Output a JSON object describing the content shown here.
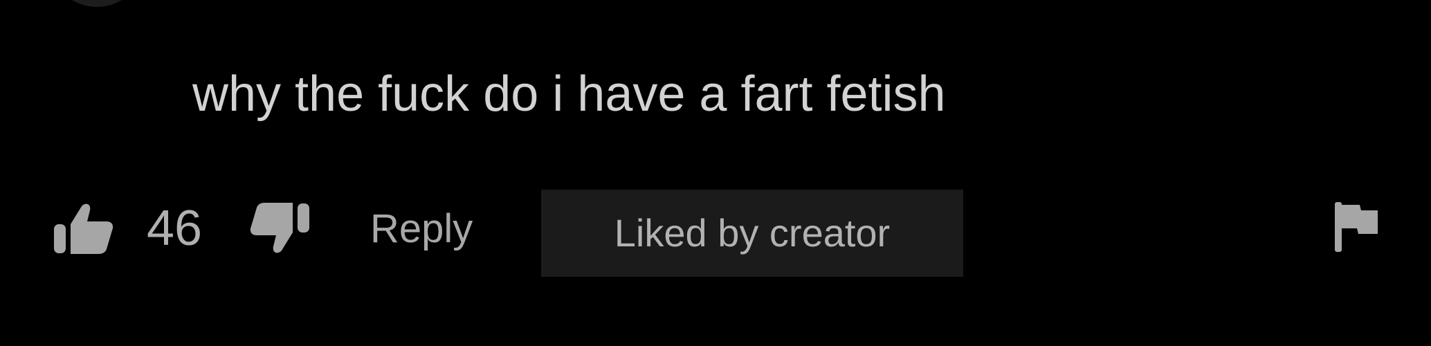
{
  "comment": {
    "text": "why the fuck do i have a fart fetish"
  },
  "actions": {
    "like_icon": "thumbs-up-icon",
    "like_count": "46",
    "dislike_icon": "thumbs-down-icon",
    "reply_label": "Reply",
    "creator_badge_label": "Liked by creator",
    "flag_icon": "flag-icon"
  },
  "colors": {
    "background": "#000000",
    "comment_text": "#d2d2d2",
    "secondary_text": "#b0b0b0",
    "badge_background": "#1b1b1b",
    "icon": "#a6a6a6"
  }
}
